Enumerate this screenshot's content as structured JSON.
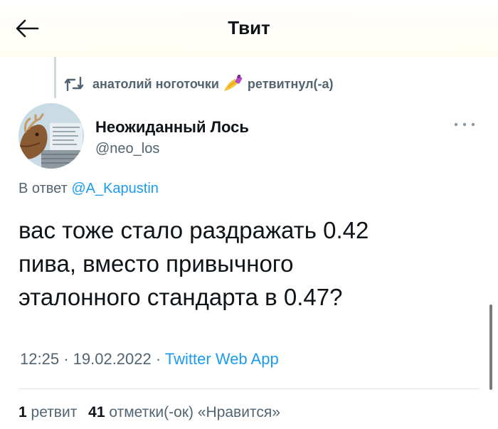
{
  "header": {
    "title": "Твит",
    "back_icon": "arrow-left-icon"
  },
  "retweet": {
    "user": "анатолий ноготочки",
    "emoji": "nail-polish-emoji",
    "suffix": "ретвитнул(-а)",
    "icon": "retweet-icon"
  },
  "tweet": {
    "display_name": "Неожиданный Лось",
    "handle": "@neo_los",
    "reply_prefix": "В ответ",
    "reply_to": "@A_Kapustin",
    "lines": [
      "вас тоже стало раздражать 0.42",
      "пива, вместо привычного",
      "эталонного стандарта в 0.47?"
    ],
    "time": "12:25",
    "date": "19.02.2022",
    "app": "Twitter Web App",
    "separator": "·",
    "more_icon": "more-dots-icon"
  },
  "stats": {
    "retweets_count": "1",
    "retweets_label": "ретвит",
    "likes_count": "41",
    "likes_label": "отметки(-ок) «Нравится»"
  },
  "colors": {
    "accent": "#1d9bf0",
    "secondary_text": "#536471",
    "primary_text": "#0f1419"
  }
}
